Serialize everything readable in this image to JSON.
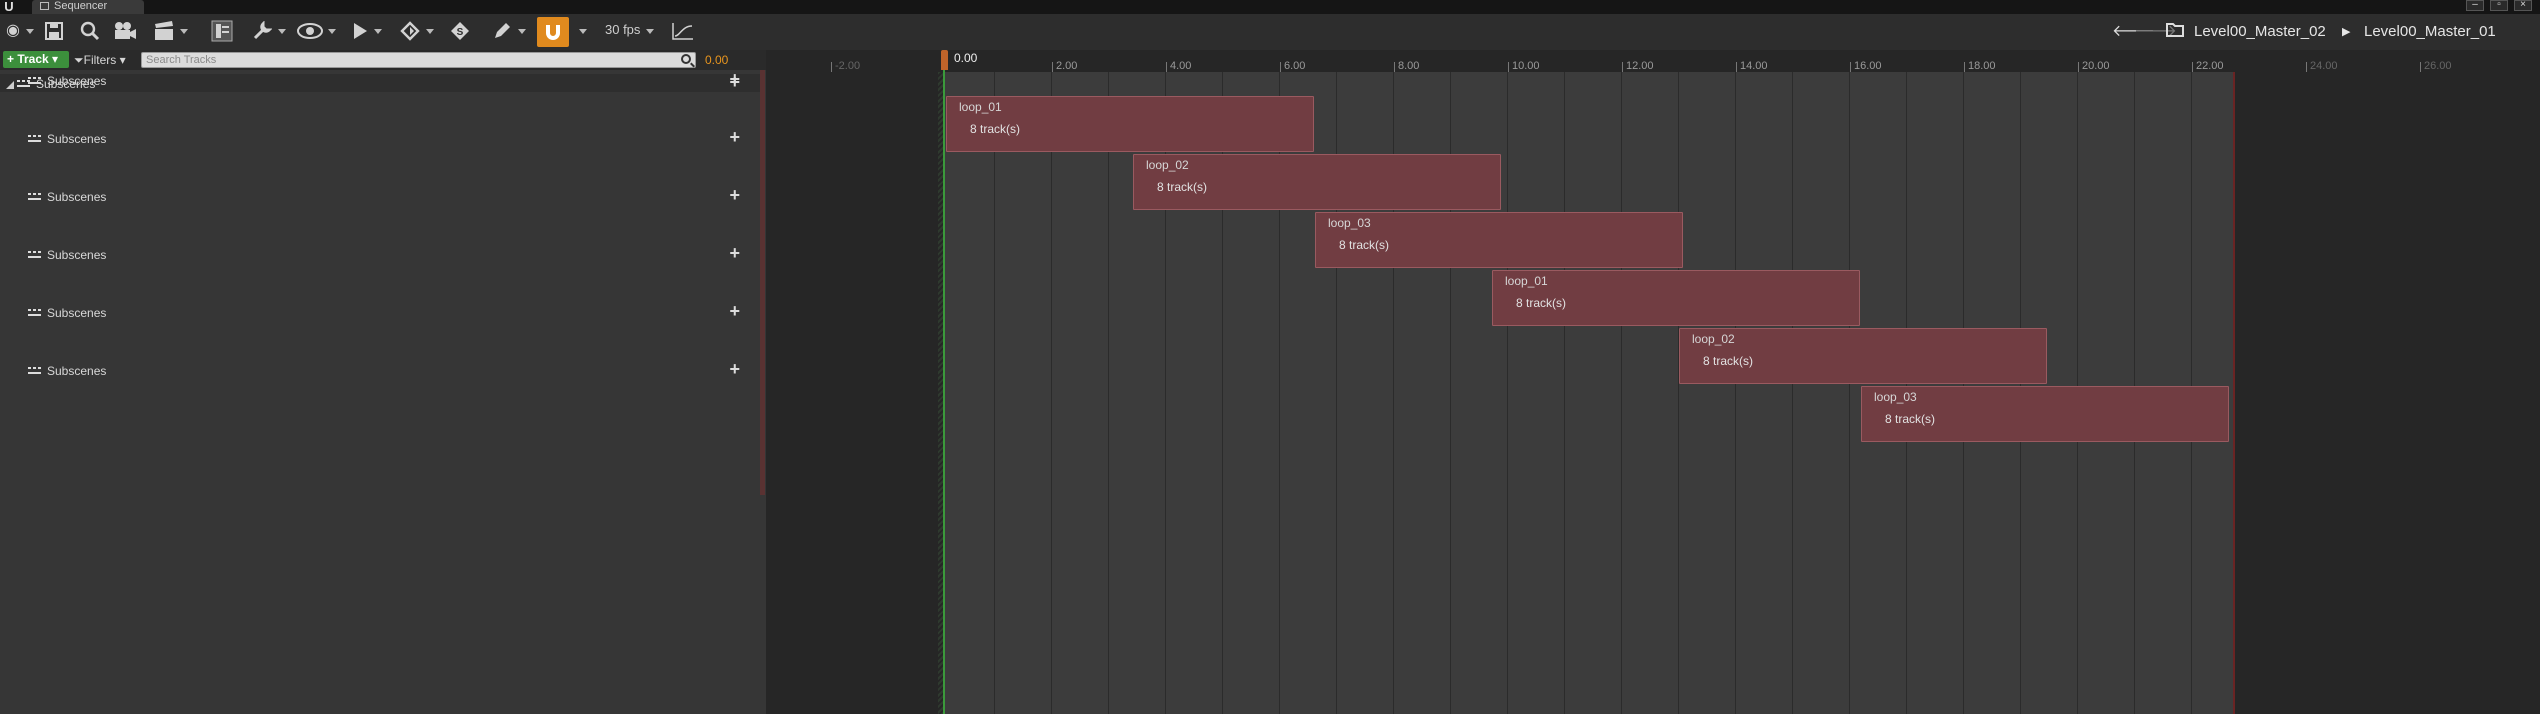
{
  "window": {
    "tab_title": "Sequencer"
  },
  "toolbar": {
    "fps_label": "30 fps",
    "breadcrumbs": [
      "Level00_Master_02",
      "Level00_Master_01"
    ],
    "snap_color": "#e08a1e"
  },
  "left_panel": {
    "add_track_label": "Track",
    "filters_label": "Filters",
    "search_placeholder": "Search Tracks",
    "current_time": "0.00",
    "master_track_label": "Subscenes",
    "rows": [
      {
        "label": "Subscenes"
      },
      {
        "label": "Subscenes"
      },
      {
        "label": "Subscenes"
      },
      {
        "label": "Subscenes"
      },
      {
        "label": "Subscenes"
      },
      {
        "label": "Subscenes"
      }
    ]
  },
  "timeline": {
    "playhead_label": "0.00",
    "ticks": [
      "-2.00",
      "2.00",
      "4.00",
      "6.00",
      "8.00",
      "10.00",
      "12.00",
      "14.00",
      "16.00",
      "18.00",
      "20.00",
      "22.00",
      "24.00",
      "26.00"
    ],
    "sections": [
      {
        "name": "loop_01",
        "tracks": "8 track(s)"
      },
      {
        "name": "loop_02",
        "tracks": "8 track(s)"
      },
      {
        "name": "loop_03",
        "tracks": "8 track(s)"
      },
      {
        "name": "loop_01",
        "tracks": "8 track(s)"
      },
      {
        "name": "loop_02",
        "tracks": "8 track(s)"
      },
      {
        "name": "loop_03",
        "tracks": "8 track(s)"
      }
    ],
    "section_color": "#713d42",
    "playback_start_color": "#3b9a3b",
    "playback_end_color": "#6a2424"
  }
}
